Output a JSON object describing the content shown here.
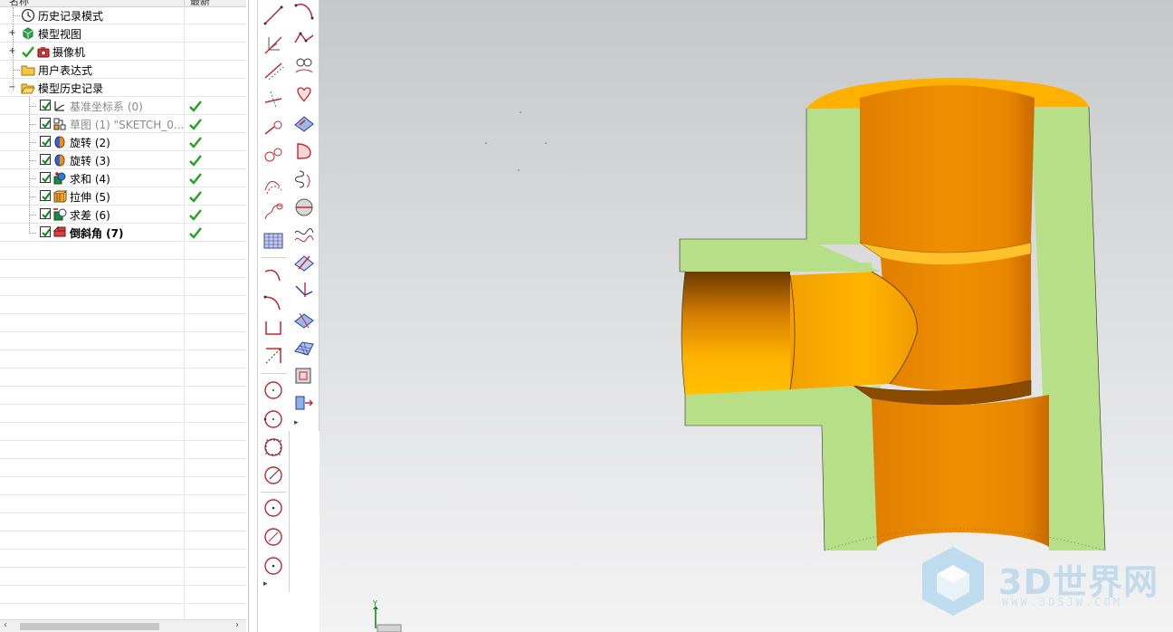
{
  "navigator": {
    "columns": [
      "名称",
      "最新"
    ],
    "rows": [
      {
        "label": "历史记录模式",
        "style": "normal",
        "icon": "clock-icon",
        "expander": ""
      },
      {
        "label": "模型视图",
        "style": "normal",
        "icon": "model-view-icon",
        "expander": "+"
      },
      {
        "label": "摄像机",
        "style": "normal",
        "icon": "camera-icon",
        "expander": "+"
      },
      {
        "label": "用户表达式",
        "style": "normal",
        "icon": "folder-icon",
        "expander": ""
      },
      {
        "label": "模型历史记录",
        "style": "normal",
        "icon": "open-folder-icon",
        "expander": "−"
      },
      {
        "label": "基准坐标系 (0)",
        "style": "gray",
        "icon": "datum-csys-icon",
        "status": "✔"
      },
      {
        "label": "草图 (1) \"SKETCH_0...",
        "style": "gray",
        "icon": "sketch-icon",
        "status": "✔"
      },
      {
        "label": "旋转 (2)",
        "style": "normal",
        "icon": "revolve-icon",
        "status": "✔"
      },
      {
        "label": "旋转 (3)",
        "style": "normal",
        "icon": "revolve-icon",
        "status": "✔"
      },
      {
        "label": "求和 (4)",
        "style": "normal",
        "icon": "unite-icon",
        "status": "✔"
      },
      {
        "label": "拉伸 (5)",
        "style": "normal",
        "icon": "extrude-icon",
        "status": "✔"
      },
      {
        "label": "求差 (6)",
        "style": "normal",
        "icon": "subtract-icon",
        "status": "✔"
      },
      {
        "label": "倒斜角 (7)",
        "style": "bold",
        "icon": "chamfer-icon",
        "status": "✔"
      }
    ],
    "scroll_left": "‹",
    "scroll_right": "›"
  },
  "toolbar_a": {
    "more": "▸",
    "icons": [
      "line-icon",
      "datum-axis-icon",
      "line-tangent-icon",
      "line-perpendicular-icon",
      "arc-point-icon",
      "circle-tangent-icon",
      "curve-offset-icon",
      "curve-bridge-icon",
      "plane-grid-icon",
      "arc-icon",
      "arc-3pt-icon",
      "rectangle-corner-icon",
      "rectangle-diagonal-icon",
      "circle-center-icon",
      "circle-3pt-icon",
      "circle-square-icon",
      "circle-edit-icon",
      "point-icon",
      "point-on-curve-icon",
      "point-center-icon"
    ]
  },
  "toolbar_b": {
    "more": "▸",
    "icons": [
      "arc-end-icon",
      "polyline-icon",
      "text-curve-icon",
      "heart-shape-icon",
      "surface-face-icon",
      "boundary-face-icon",
      "helix-curve-icon",
      "sphere-section-icon",
      "wave-curve-icon",
      "trim-surface-icon",
      "project-curve-icon",
      "plane-intersect-icon",
      "mesh-surface-icon",
      "section-view-icon",
      "cylinder-arrow-icon"
    ]
  },
  "viewport": {
    "colors": {
      "body": "#e88a00",
      "section": "#b6df87",
      "top_rim": "#ffb400",
      "groove": "#ffc526"
    },
    "watermark": {
      "main": "3D世界网",
      "sub": "WWW.3DSJW.COM"
    },
    "triad_label": "Y"
  }
}
